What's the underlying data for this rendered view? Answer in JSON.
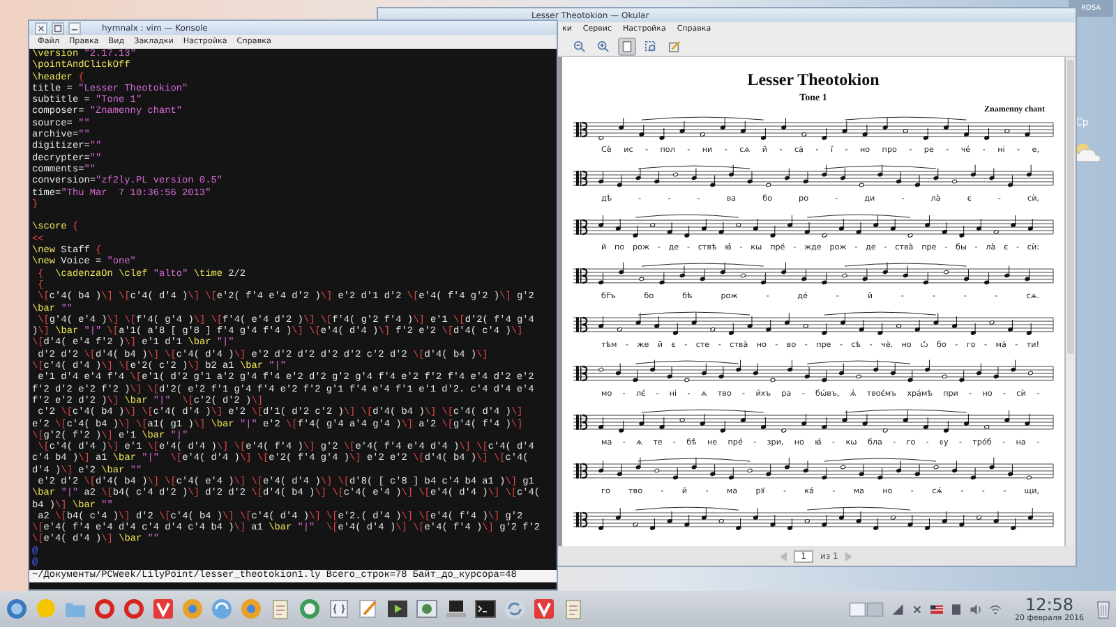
{
  "desktop": {
    "widget_label": "ROSA",
    "weekday": "Ср"
  },
  "konsole": {
    "title": "hymnalx : vim — Konsole",
    "menu": [
      "Файл",
      "Правка",
      "Вид",
      "Закладки",
      "Настройка",
      "Справка"
    ],
    "blocks": [
      [
        "\\version \"2.17.13\"",
        "\\pointAndClickOff",
        "\\header {",
        "title = \"Lesser Theotokion\"",
        "subtitle = \"Tone 1\"",
        "composer= \"Znamenny chant\"",
        "source= \"\"",
        "archive=\"\"",
        "digitizer=\"\"",
        "decrypter=\"\"",
        "comments=\"\"",
        "conversion=\"zf2ly.PL version 0.5\"",
        "time=\"Thu Mar  7 10:36:56 2013\"",
        "}"
      ],
      [
        "\\score {",
        "<<",
        "\\new Staff {",
        "\\new Voice = \"one\"",
        " {  \\cadenzaOn \\clef \"alto\" \\time 2/2",
        " {",
        " \\[c'4( b4 )\\] \\[c'4( d'4 )\\] \\[e'2( f'4 e'4 d'2 )\\] e'2 d'1 d'2 \\[e'4( f'4 g'2 )\\] g'2",
        "\\bar \"\"",
        " \\[g'4( e'4 )\\] \\[f'4( g'4 )\\] \\[f'4( e'4 d'2 )\\] \\[f'4( g'2 f'4 )\\] e'1 \\[d'2( f'4 g'4",
        ")\\] \\bar \"|\" \\[a'1( a'8 [ g'8 ] f'4 g'4 f'4 )\\] \\[e'4( d'4 )\\] f'2 e'2 \\[d'4( c'4 )\\]",
        "\\[d'4( e'4 f'2 )\\] e'1 d'1 \\bar \"|\"",
        " d'2 d'2 \\[d'4( b4 )\\] \\[c'4( d'4 )\\] e'2 d'2 d'2 d'2 d'2 c'2 d'2 \\[d'4( b4 )\\]",
        "\\[c'4( d'4 )\\] \\[e'2( c'2 )\\] b2 a1 \\bar \"|\"",
        " e'1 d'4 e'4 f'4 \\[e'1( d'2 g'1 a'2 g'4 f'4 e'2 d'2 g'2 g'4 f'4 e'2 f'2 f'4 e'4 d'2 e'2",
        "f'2 d'2 e'2 f'2 )\\] \\[d'2( e'2 f'1 g'4 f'4 e'2 f'2 g'1 f'4 e'4 f'1 e'1 d'2. c'4 d'4 e'4",
        "f'2 e'2 d'2 )\\] \\bar \"|\"  \\[c'2( d'2 )\\]",
        " c'2 \\[c'4( b4 )\\] \\[c'4( d'4 )\\] e'2 \\[d'1( d'2 c'2 )\\] \\[d'4( b4 )\\] \\[c'4( d'4 )\\]",
        "e'2 \\[c'4( b4 )\\] \\[a1( g1 )\\] \\bar \"|\" e'2 \\[f'4( g'4 a'4 g'4 )\\] a'2 \\[g'4( f'4 )\\]",
        "\\[g'2( f'2 )\\] e'1 \\bar \"|\"",
        " \\[c'4( d'4 )\\] e'1 \\[e'4( d'4 )\\] \\[e'4( f'4 )\\] g'2 \\[e'4( f'4 e'4 d'4 )\\] \\[c'4( d'4",
        "c'4 b4 )\\] a1 \\bar \"|\"  \\[e'4( d'4 )\\] \\[e'2( f'4 g'4 )\\] e'2 e'2 \\[d'4( b4 )\\] \\[c'4(",
        "d'4 )\\] e'2 \\bar \"\"",
        " e'2 d'2 \\[d'4( b4 )\\] \\[c'4( e'4 )\\] \\[e'4( d'4 )\\] \\[d'8( [ c'8 ] b4 c'4 b4 a1 )\\] g1",
        "\\bar \"|\" a2 \\[b4( c'4 d'2 )\\] d'2 d'2 \\[d'4( b4 )\\] \\[c'4( e'4 )\\] \\[e'4( d'4 )\\] \\[c'4(",
        "b4 )\\] \\bar \"\"",
        " a2 \\[b4( c'4 )\\] d'2 \\[c'4( b4 )\\] \\[c'4( d'4 )\\] \\[e'2.( d'4 )\\] \\[e'4( f'4 )\\] g'2",
        "\\[e'4( f'4 e'4 d'4 c'4 d'4 c'4 b4 )\\] a1 \\bar \"|\"  \\[e'4( d'4 )\\] \\[e'4( f'4 )\\] g'2 f'2",
        "\\[e'4( d'4 )\\] \\bar \"\"",
        "@",
        "@"
      ]
    ],
    "status_line": "~/Документы/PCWeek/LilyPoint/lesser_theotokion1.ly Всего_строк=78 Байт_до_курсора=48"
  },
  "okular": {
    "title": "Lesser Theotokion — Okular",
    "menu": [
      "ки",
      "Сервис",
      "Настройка",
      "Справка"
    ],
    "tools": [
      {
        "kind": "zoom-out",
        "selected": false
      },
      {
        "kind": "zoom-in",
        "selected": false
      },
      {
        "kind": "browse",
        "selected": true
      },
      {
        "kind": "select",
        "selected": false
      },
      {
        "kind": "annotate",
        "selected": false
      }
    ],
    "score": {
      "title": "Lesser Theotokion",
      "subtitle": "Tone 1",
      "composer": "Znamenny chant",
      "lyrics": [
        "Сѐ ис - пол - ни - сѧ й - сá - ї - но про - ре - чé - ні - е,",
        "дѣ - - - ва бо ро - ди - лà є - сѝ,",
        "й по рож - де - ствѣ ꙗ҆ - кѡ прé - жде рож - де - ствà пре - бы - лà є - сѝ:",
        "бг҃ъ бо бѣ рож - дé - й - - - - сѧ.",
        "тѣм - же й є - сте - ствà но - во - пре - сѣ - чè. но ѽ бо - го - мá - ти!",
        "мо - лє́ - ні - ѧ тво - и́хъ ра - бѡ́въ, ѧ҆ твоє́мъ хра́мѣ при - но - сѝ -",
        "ма - ѧ те - бѣ̀ не прé - зри, но ꙗ҆ - кѡ бла - го - ᲂу - трóб - на -",
        "го тво - й - ма рꙋ - кá - ма но - сѧ́ - - - щи,"
      ]
    },
    "page_nav": {
      "page": "1",
      "total": "из 1"
    }
  },
  "taskbar": {
    "clock": "12:58",
    "date": "20 февраля 2016"
  }
}
